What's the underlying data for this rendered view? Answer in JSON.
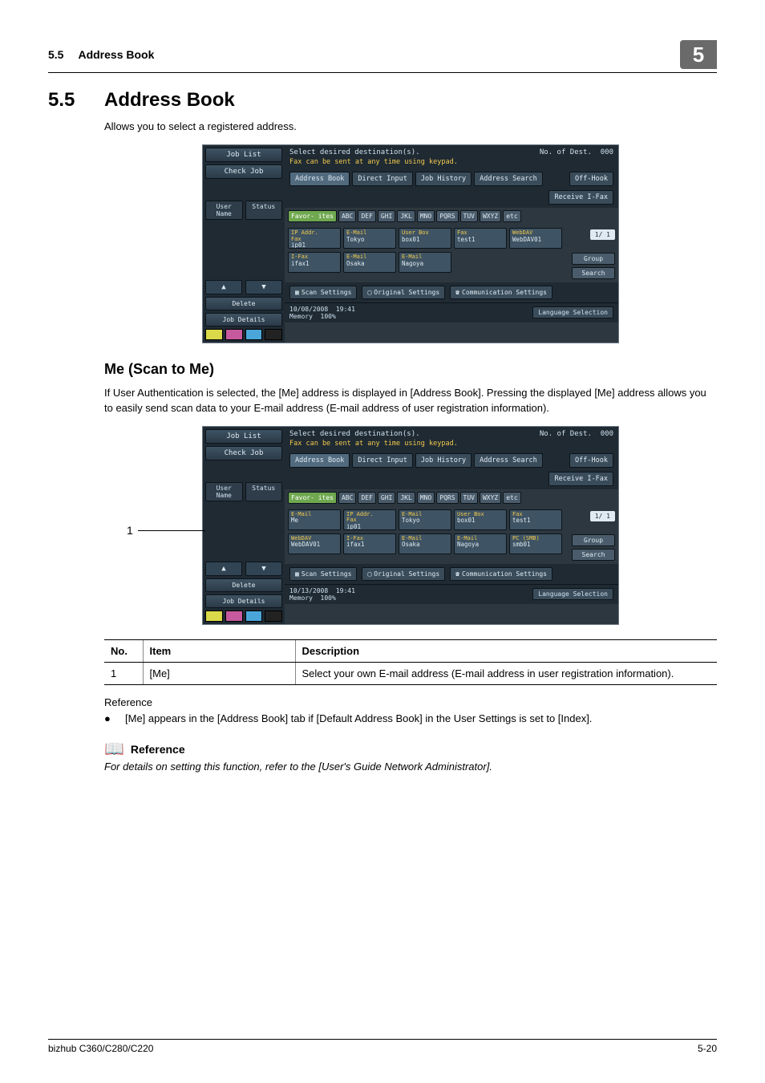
{
  "header": {
    "section_num": "5.5",
    "section_title": "Address Book",
    "chapter": "5"
  },
  "h2": {
    "num": "5.5",
    "title": "Address Book"
  },
  "intro": "Allows you to select a registered address.",
  "h3": "Me (Scan to Me)",
  "me_para": "If User Authentication is selected, the [Me] address is displayed in [Address Book]. Pressing the displayed [Me] address allows you to easily send scan data to your E-mail address (E-mail address of user registration information).",
  "callout_num": "1",
  "table": {
    "headers": {
      "no": "No.",
      "item": "Item",
      "desc": "Description"
    },
    "row1": {
      "no": "1",
      "item": "[Me]",
      "desc": "Select your own E-mail address (E-mail address in user registration information)."
    }
  },
  "reference_hdr": "Reference",
  "bullet": "[Me] appears in the [Address Book] tab if [Default Address Book] in the User Settings is set to [Index].",
  "ref2_label": "Reference",
  "ref2_line": "For details on setting this function, refer to the [User's Guide Network Administrator].",
  "footer": {
    "left": "bizhub C360/C280/C220",
    "right": "5-20"
  },
  "panel_common": {
    "topmsg": "Select desired destination(s).",
    "fax_note": "Fax can be sent at any time using keypad.",
    "dest_label": "No. of\nDest.",
    "dest_count": "000",
    "tabs": {
      "addr": "Address Book",
      "direct": "Direct Input",
      "hist": "Job History",
      "search": "Address\nSearch",
      "offhook": "Off-Hook",
      "ifax": "Receive\nI-Fax"
    },
    "filters": [
      "Favor-\nites",
      "ABC",
      "DEF",
      "GHI",
      "JKL",
      "MNO",
      "PQRS",
      "TUV",
      "WXYZ",
      "etc"
    ],
    "page_ind": "1/  1",
    "side": {
      "group": "Group",
      "search": "Search"
    },
    "bottom": {
      "scan": "Scan Settings",
      "orig": "Original Settings",
      "comm": "Communication\nSettings"
    },
    "left": {
      "joblist": "Job List",
      "checkjob": "Check Job",
      "user": "User\nName",
      "status": "Status",
      "delete": "Delete",
      "jobdetails": "Job Details",
      "up": "▲",
      "down": "▼"
    },
    "toner": {
      "y": "Y",
      "m": "M",
      "c": "C",
      "k": "K"
    },
    "lang": "Language Selection"
  },
  "panel1": {
    "date": "10/08/2008",
    "time": "19:41",
    "memory": "Memory",
    "mem_pct": "100%",
    "dests_row1": [
      {
        "l1": "IP Addr.\nFax",
        "l2": "ip01"
      },
      {
        "l1": "E-Mail",
        "l2": "Tokyo"
      },
      {
        "l1": "User Box",
        "l2": "box01"
      },
      {
        "l1": "Fax",
        "l2": "test1"
      },
      {
        "l1": "WebDAV",
        "l2": "WebDAV01"
      }
    ],
    "dests_row2": [
      {
        "l1": "I-Fax",
        "l2": "ifax1"
      },
      {
        "l1": "E-Mail",
        "l2": "Osaka"
      },
      {
        "l1": "E-Mail",
        "l2": "Nagoya"
      }
    ]
  },
  "panel2": {
    "date": "10/13/2008",
    "time": "19:41",
    "memory": "Memory",
    "mem_pct": "100%",
    "dests_row1": [
      {
        "l1": "E-Mail",
        "l2": "Me"
      },
      {
        "l1": "IP Addr.\nFax",
        "l2": "ip01"
      },
      {
        "l1": "E-Mail",
        "l2": "Tokyo"
      },
      {
        "l1": "User Box",
        "l2": "box01"
      },
      {
        "l1": "Fax",
        "l2": "test1"
      }
    ],
    "dests_row2": [
      {
        "l1": "WebDAV",
        "l2": "WebDAV01"
      },
      {
        "l1": "I-Fax",
        "l2": "ifax1"
      },
      {
        "l1": "E-Mail",
        "l2": "Osaka"
      },
      {
        "l1": "E-Mail",
        "l2": "Nagoya"
      },
      {
        "l1": "PC (SMB)",
        "l2": "smb01"
      }
    ]
  }
}
